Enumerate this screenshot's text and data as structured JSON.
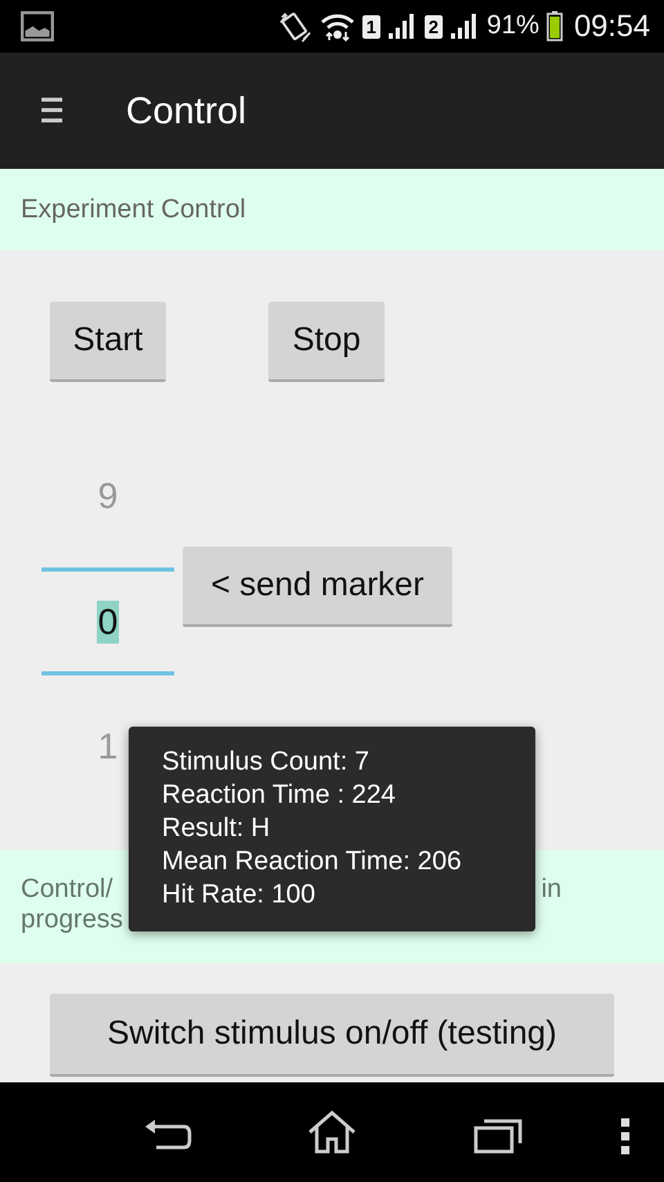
{
  "status_bar": {
    "sim_1": "1",
    "sim_2": "2",
    "battery": "91%",
    "time": "09:54"
  },
  "app_bar": {
    "title": "Control"
  },
  "section": {
    "title": "Experiment Control"
  },
  "buttons": [
    {
      "label": "Start"
    },
    {
      "label": "Stop"
    }
  ],
  "picker": {
    "items": [
      {
        "value": "9",
        "selected": false
      },
      {
        "value": "0",
        "selected": true
      },
      {
        "value": "1",
        "selected": false
      }
    ]
  },
  "send_button": {
    "label": "< send marker"
  },
  "status": {
    "line_start": "Control/",
    "line_end": "in",
    "line_2": "progress"
  },
  "switch_button": {
    "label": "Switch stimulus on/off (testing)"
  },
  "toast": {
    "lines": [
      "Stimulus Count: 7",
      "Reaction Time : 224",
      "Result: H",
      "Mean Reaction Time: 206",
      "Hit Rate: 100"
    ]
  }
}
